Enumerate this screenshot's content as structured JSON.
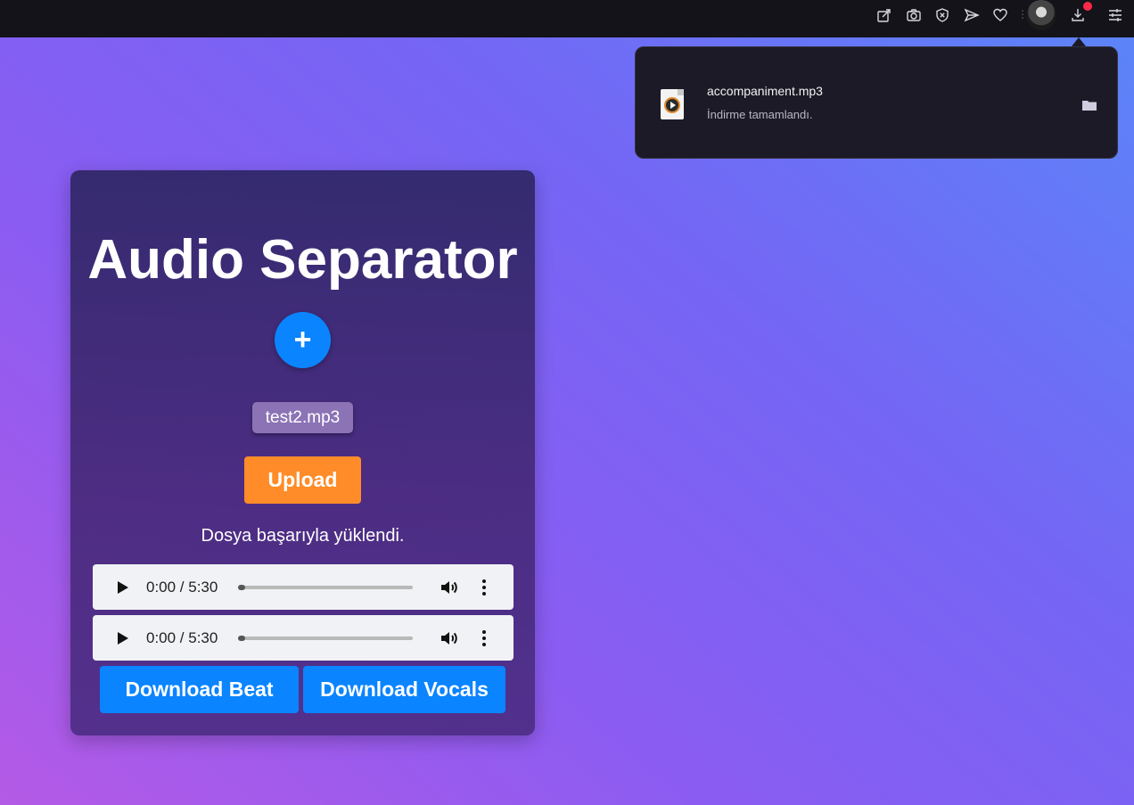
{
  "browser_toolbar": {
    "icons": [
      "edit-share-icon",
      "camera-icon",
      "shield-icon",
      "send-icon",
      "heart-icon",
      "avatar",
      "download-icon",
      "settings-sliders-icon"
    ],
    "download_badge_color": "#ff2a4a"
  },
  "download_panel": {
    "file_name": "accompaniment.mp3",
    "status": "İndirme tamamlandı."
  },
  "app": {
    "title": "Audio Separator",
    "add_button_label": "+",
    "selected_file": "test2.mp3",
    "upload_label": "Upload",
    "status_message": "Dosya başarıyla yüklendi.",
    "players": [
      {
        "time": "0:00 / 5:30",
        "progress": 0.0
      },
      {
        "time": "0:00 / 5:30",
        "progress": 0.0
      }
    ],
    "download_beat_label": "Download Beat",
    "download_vocals_label": "Download Vocals"
  },
  "colors": {
    "primary_blue": "#0a84ff",
    "upload_orange": "#ff8c28",
    "topbar": "#14131a"
  }
}
